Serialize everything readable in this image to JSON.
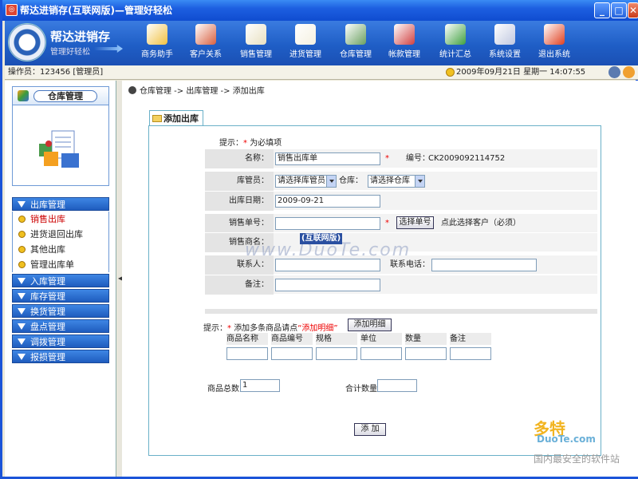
{
  "window": {
    "title": "帮达进销存(互联网版)—管理好轻松",
    "app_icon": "app-icon",
    "min_label": "_",
    "max_label": "□",
    "close_label": "✕"
  },
  "brand": {
    "name": "帮达进销存",
    "slogan": "管理好轻松"
  },
  "toolbar": {
    "items": [
      {
        "label": "商务助手",
        "icon": "assistant-icon",
        "color": "#f0c040"
      },
      {
        "label": "客户关系",
        "icon": "customers-icon",
        "color": "#d86040"
      },
      {
        "label": "销售管理",
        "icon": "sales-icon",
        "color": "#e8e0c0"
      },
      {
        "label": "进货管理",
        "icon": "purchase-icon",
        "color": "#f4f0e0"
      },
      {
        "label": "仓库管理",
        "icon": "warehouse-icon",
        "color": "#6aa060"
      },
      {
        "label": "帐款管理",
        "icon": "accounts-icon",
        "color": "#d04040"
      },
      {
        "label": "统计汇总",
        "icon": "statistics-icon",
        "color": "#40a040"
      },
      {
        "label": "系统设置",
        "icon": "settings-icon",
        "color": "#c0c8e0"
      },
      {
        "label": "退出系统",
        "icon": "exit-icon",
        "color": "#e04020"
      }
    ]
  },
  "status": {
    "operator": "操作员：123456 [管理员]",
    "datetime": "2009年09月21日  星期一  14:07:55"
  },
  "sidebar": {
    "module_title": "仓库管理",
    "groups": [
      {
        "label": "出库管理"
      },
      {
        "label": "入库管理"
      },
      {
        "label": "库存管理"
      },
      {
        "label": "换货管理"
      },
      {
        "label": "盘点管理"
      },
      {
        "label": "调拨管理"
      },
      {
        "label": "报损管理"
      }
    ],
    "sub_items": [
      {
        "label": "销售出库"
      },
      {
        "label": "进货退回出库"
      },
      {
        "label": "其他出库"
      },
      {
        "label": "管理出库单"
      }
    ]
  },
  "breadcrumb": "仓库管理 -> 出库管理 -> 添加出库",
  "tab": {
    "label": "添加出库"
  },
  "form": {
    "hint_prefix": "提示：",
    "hint_star": "*",
    "hint_text": "为必填项",
    "name_label": "名称：",
    "name_value": "销售出库单",
    "code_label": "编号：",
    "code_value": "CK2009092114752",
    "keeper_label": "库管员：",
    "keeper_value": "请选择库管员",
    "warehouse_label": "仓库：",
    "warehouse_value": "请选择仓库",
    "date_label": "出库日期：",
    "date_value": "2009-09-21",
    "order_label": "销售单号：",
    "order_value": "",
    "select_order_button": "选择单号",
    "customer_hint": "点此选择客户（必须）",
    "merchant_label": "销售商名：",
    "contact_label": "联系人：",
    "contact_value": "",
    "phone_label": "联系电话：",
    "phone_value": "",
    "remark_label": "备注：",
    "remark_value": ""
  },
  "details": {
    "hint_prefix": "提示：",
    "hint_star": "*",
    "hint_text": "添加多条商品请点",
    "hint_link": "“添加明细”",
    "add_detail_button": "添加明细",
    "columns": [
      "商品名称",
      "商品编号",
      "规格",
      "单位",
      "数量",
      "备注"
    ],
    "total_items_label": "商品总数",
    "total_items_value": "1",
    "total_qty_label": "合计数量",
    "total_qty_value": "",
    "add_button": "添  加"
  },
  "watermark": {
    "url": "www.DuoTe.com",
    "tag": "(互联网版)",
    "site": "多特",
    "site_en": "DuoTe.com",
    "site_slogan": "国内最安全的软件站"
  }
}
